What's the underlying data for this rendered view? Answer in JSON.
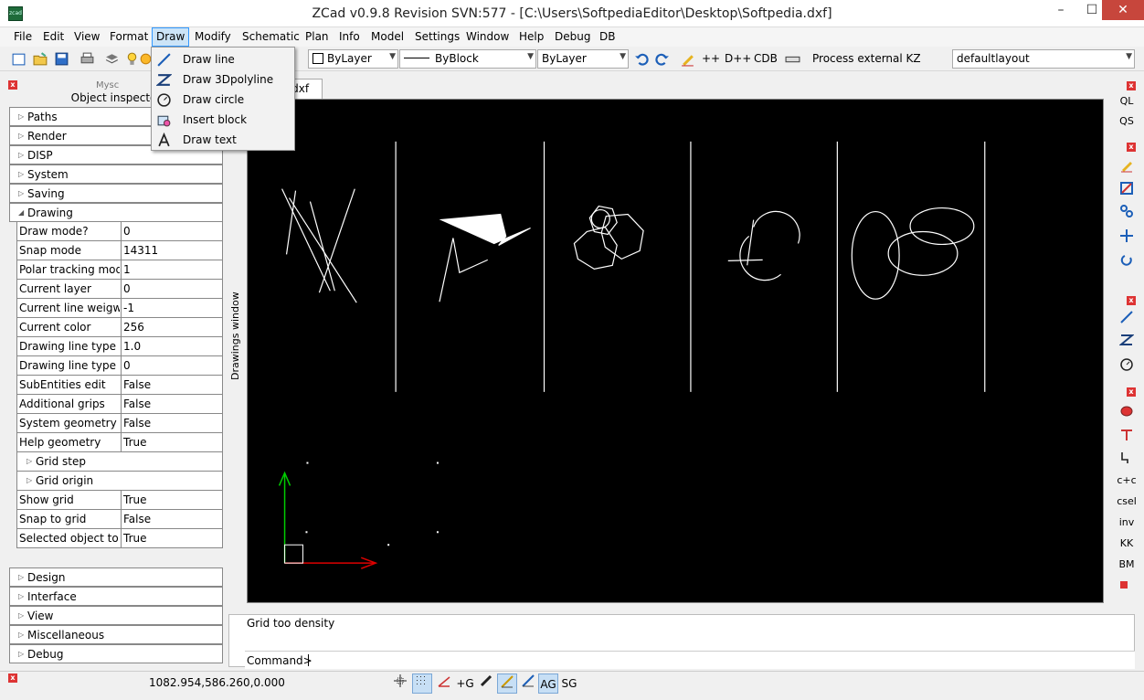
{
  "window": {
    "title": "ZCad v0.9.8 Revision SVN:577 - [C:\\Users\\SoftpediaEditor\\Desktop\\Softpedia.dxf]",
    "app_icon_text": "zcad",
    "minimize": "–",
    "maximize": "☐",
    "close": "✕"
  },
  "menu": [
    "File",
    "Edit",
    "View",
    "Format",
    "Draw",
    "Modify",
    "Schematic",
    "Plan",
    "Info",
    "Model",
    "Settings",
    "Window",
    "Help",
    "Debug",
    "DB"
  ],
  "toolbar": {
    "layer_value": "ByLayer",
    "linetype_value": "ByBlock",
    "lineweight_value": "ByLayer",
    "text_pp": "++",
    "text_dpp": "D++",
    "text_cdb": "CDB",
    "process_label": "Process external KZ",
    "layout_value": "defaultlayout"
  },
  "draw_menu": [
    {
      "label": "Draw line",
      "icon": "line-icon"
    },
    {
      "label": "Draw 3Dpolyline",
      "icon": "polyline-icon"
    },
    {
      "label": "Draw circle",
      "icon": "circle-icon"
    },
    {
      "label": "Insert block",
      "icon": "insert-block-icon"
    },
    {
      "label": "Draw text",
      "icon": "text-icon"
    }
  ],
  "panel": {
    "header_obscured": "Mysc",
    "title": "Object inspector",
    "sections_top": [
      "Paths",
      "Render",
      "DISP",
      "System",
      "Saving"
    ],
    "drawing_section": "Drawing",
    "properties": [
      {
        "key": "Draw mode?",
        "value": "0"
      },
      {
        "key": "Snap mode",
        "value": "14311"
      },
      {
        "key": "Polar tracking mode",
        "value": "1"
      },
      {
        "key": "Current layer",
        "value": "0"
      },
      {
        "key": "Current line weigwt",
        "value": "-1"
      },
      {
        "key": "Current color",
        "value": "256"
      },
      {
        "key": "Drawing line type scale",
        "value": "1.0"
      },
      {
        "key": "Drawing line type",
        "value": "0"
      },
      {
        "key": "SubEntities edit",
        "value": "False"
      },
      {
        "key": "Additional grips",
        "value": "False"
      },
      {
        "key": "System geometry",
        "value": "False"
      },
      {
        "key": "Help geometry",
        "value": "True"
      }
    ],
    "sub_sections": [
      "Grid step",
      "Grid origin"
    ],
    "properties2": [
      {
        "key": "Show grid",
        "value": "True"
      },
      {
        "key": "Snap to grid",
        "value": "False"
      },
      {
        "key": "Selected object to inspector",
        "value": "True"
      }
    ],
    "sections_bottom": [
      "Design",
      "Interface",
      "View",
      "Miscellaneous",
      "Debug"
    ]
  },
  "drawings_window_label": "Drawings window",
  "doc_tab": "a.dxf",
  "right_toolbar": {
    "ql": "QL",
    "qs": "QS",
    "cc": "c+c",
    "csel": "csel",
    "inv": "inv",
    "kk": "KK",
    "bm": "BM"
  },
  "command": {
    "message": "Grid too density",
    "prompt": "Command>"
  },
  "status": {
    "coords": "1082.954,586.260,0.000",
    "plus_g": "+G",
    "ag": "AG",
    "sg": "SG"
  }
}
